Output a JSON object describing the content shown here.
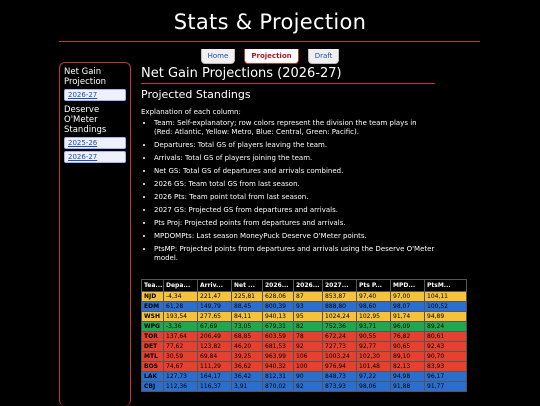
{
  "site_title": "Stats & Projection",
  "tabs": [
    {
      "label": "Home",
      "active": false
    },
    {
      "label": "Projection",
      "active": true
    },
    {
      "label": "Draft",
      "active": false
    }
  ],
  "sidebar": {
    "sections": [
      {
        "title": "Net Gain Projection",
        "links": [
          "2026-27"
        ]
      },
      {
        "title": "Deserve O'Meter Standings",
        "links": [
          "2025-26",
          "2026-27"
        ]
      }
    ]
  },
  "main": {
    "heading": "Net Gain Projections (2026-27)",
    "sub_heading": "Projected Standings",
    "explain_label": "Explanation of each column:",
    "columns_explained": [
      "Team: Self-explanatory; row colors represent the division the team plays in (Red: Atlantic, Yellow: Metro, Blue: Central, Green: Pacific).",
      "Departures: Total GS of players leaving the team.",
      "Arrivals: Total GS of players joining the team.",
      "Net GS: Total GS of departures and arrivals combined.",
      "2026 GS: Team total GS from last season.",
      "2026 Pts: Team point total from last season.",
      "2027 GS: Projected GS from departures and arrivals.",
      "Pts Proj: Projected points from departures and arrivals.",
      "MPDOMPts: Last season MoneyPuck Deserve O'Meter points.",
      "PtsMP: Projected points from departures and arrivals using the Deserve O'Meter model."
    ]
  },
  "division_colors": {
    "Atlantic": "#e8402e",
    "Metro": "#f5c23a",
    "Central": "#2a6fcf",
    "Pacific": "#1fa84f"
  },
  "table": {
    "headers": [
      "Tea...",
      "Depa...",
      "Arriv...",
      "Net ...",
      "2026...",
      "2026...",
      "2027...",
      "Pts P...",
      "MPD...",
      "PtsM..."
    ],
    "rows": [
      {
        "division": "Metro",
        "cells": [
          "NJD",
          "-4,34",
          "221,47",
          "225,81",
          "628,06",
          "87",
          "853,87",
          "97,40",
          "97,00",
          "104,11"
        ]
      },
      {
        "division": "Central",
        "cells": [
          "EDM",
          "61,28",
          "149,79",
          "88,45",
          "800,39",
          "93",
          "888,80",
          "98,60",
          "98,07",
          "100,52"
        ]
      },
      {
        "division": "Metro",
        "cells": [
          "WSH",
          "193,54",
          "277,65",
          "84,11",
          "940,13",
          "95",
          "1024,24",
          "102,95",
          "91,74",
          "94,89"
        ]
      },
      {
        "division": "Pacific",
        "cells": [
          "WPG",
          "-3,36",
          "67,69",
          "73,05",
          "679,31",
          "82",
          "752,36",
          "93,71",
          "96,09",
          "89,24"
        ]
      },
      {
        "division": "Atlantic",
        "cells": [
          "TOR",
          "137,64",
          "206,49",
          "68,85",
          "603,59",
          "78",
          "672,24",
          "90,55",
          "76,82",
          "80,61"
        ]
      },
      {
        "division": "Atlantic",
        "cells": [
          "DET",
          "77,62",
          "123,82",
          "46,20",
          "681,53",
          "92",
          "727,73",
          "92,77",
          "90,65",
          "92,43"
        ]
      },
      {
        "division": "Atlantic",
        "cells": [
          "MTL",
          "30,59",
          "69,84",
          "39,25",
          "963,99",
          "106",
          "1003,24",
          "102,30",
          "89,10",
          "90,70"
        ]
      },
      {
        "division": "Atlantic",
        "cells": [
          "BOS",
          "74,67",
          "111,29",
          "36,62",
          "940,32",
          "100",
          "976,94",
          "101,48",
          "82,13",
          "83,93"
        ]
      },
      {
        "division": "Central",
        "cells": [
          "LAK",
          "127,73",
          "164,17",
          "36,42",
          "812,31",
          "90",
          "848,73",
          "97,22",
          "94,98",
          "96,17"
        ]
      },
      {
        "division": "Central",
        "cells": [
          "CBJ",
          "112,36",
          "116,37",
          "3,91",
          "870,02",
          "92",
          "873,93",
          "98,06",
          "91,88",
          "91,77"
        ]
      }
    ]
  }
}
